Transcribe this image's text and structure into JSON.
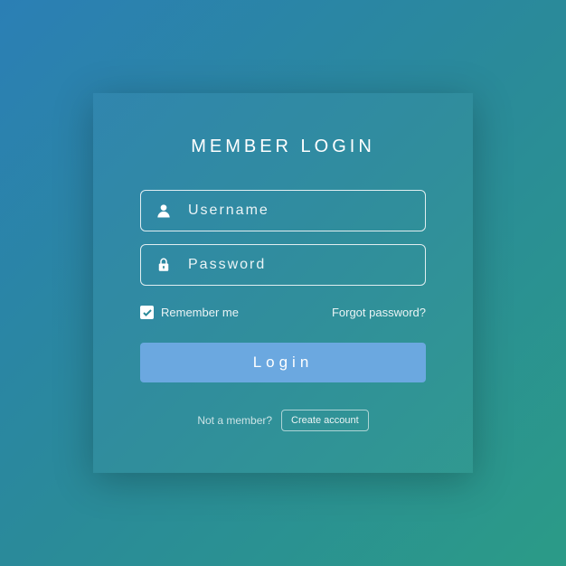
{
  "title": "MEMBER LOGIN",
  "username": {
    "placeholder": "Username",
    "value": ""
  },
  "password": {
    "placeholder": "Password",
    "value": ""
  },
  "remember_label": "Remember me",
  "remember_checked": true,
  "forgot_label": "Forgot password?",
  "login_button": "Login",
  "not_member_text": "Not a member?",
  "create_account_button": "Create account"
}
